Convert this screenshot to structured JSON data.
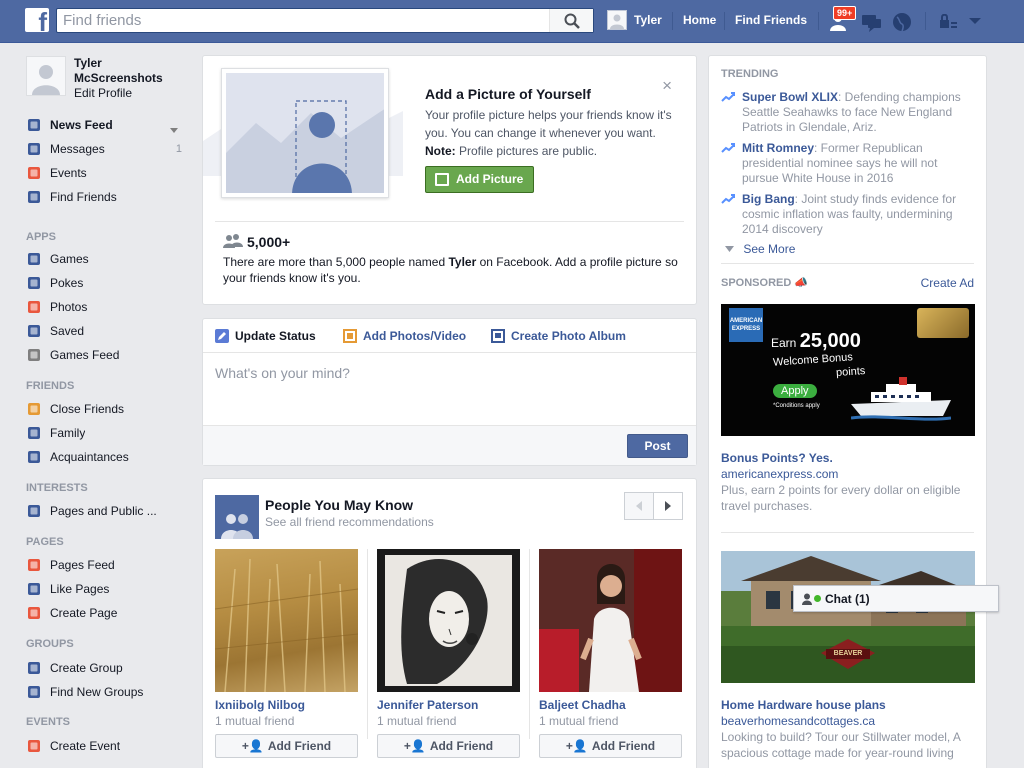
{
  "topbar": {
    "logo": "f",
    "search_placeholder": "Find friends",
    "user_name": "Tyler",
    "home_label": "Home",
    "find_friends_label": "Find Friends",
    "notification_count": "99+"
  },
  "sidebar": {
    "profile_name": "Tyler McScreenshots",
    "edit_profile": "Edit Profile",
    "favorites": [
      {
        "label": "News Feed",
        "icon": "news-feed-icon"
      },
      {
        "label": "Messages",
        "icon": "messages-icon",
        "count": "1"
      },
      {
        "label": "Events",
        "icon": "events-icon"
      },
      {
        "label": "Find Friends",
        "icon": "find-friends-icon"
      }
    ],
    "apps_title": "APPS",
    "apps": [
      {
        "label": "Games",
        "icon": "games-icon"
      },
      {
        "label": "Pokes",
        "icon": "pokes-icon"
      },
      {
        "label": "Photos",
        "icon": "photos-icon"
      },
      {
        "label": "Saved",
        "icon": "saved-icon"
      },
      {
        "label": "Games Feed",
        "icon": "games-feed-icon"
      }
    ],
    "friends_title": "FRIENDS",
    "friends": [
      {
        "label": "Close Friends",
        "icon": "close-friends-icon"
      },
      {
        "label": "Family",
        "icon": "family-icon"
      },
      {
        "label": "Acquaintances",
        "icon": "acquaintances-icon"
      }
    ],
    "interests_title": "INTERESTS",
    "interests": [
      {
        "label": "Pages and Public ...",
        "icon": "pages-public-icon"
      }
    ],
    "pages_title": "PAGES",
    "pages": [
      {
        "label": "Pages Feed",
        "icon": "pages-feed-icon"
      },
      {
        "label": "Like Pages",
        "icon": "like-pages-icon"
      },
      {
        "label": "Create Page",
        "icon": "create-page-icon"
      }
    ],
    "groups_title": "GROUPS",
    "groups": [
      {
        "label": "Create Group",
        "icon": "create-group-icon"
      },
      {
        "label": "Find New Groups",
        "icon": "find-groups-icon"
      }
    ],
    "events_title": "EVENTS",
    "events": [
      {
        "label": "Create Event",
        "icon": "create-event-icon"
      }
    ]
  },
  "photo_prompt": {
    "title": "Add a Picture of Yourself",
    "desc_pre": "Your profile picture helps your friends know it's you. You can change it whenever you want. ",
    "desc_note": "Note:",
    "desc_post": " Profile pictures are public.",
    "button": "Add Picture",
    "close": "×",
    "count": "5,000+",
    "count_desc_pre": "There are more than 5,000 people named ",
    "count_name": "Tyler",
    "count_desc_post": " on Facebook. Add a profile picture so your friends know it's you."
  },
  "composer": {
    "tab_status": "Update Status",
    "tab_photos": "Add Photos/Video",
    "tab_album": "Create Photo Album",
    "placeholder": "What's on your mind?",
    "post": "Post"
  },
  "pymk": {
    "title": "People You May Know",
    "subtitle": "See all friend recommendations",
    "people": [
      {
        "name": "Ixniibolg Nilbog",
        "mutual": "1 mutual friend",
        "button": "Add Friend"
      },
      {
        "name": "Jennifer Paterson",
        "mutual": "1 mutual friend",
        "button": "Add Friend"
      },
      {
        "name": "Baljeet Chadha",
        "mutual": "1 mutual friend",
        "button": "Add Friend"
      }
    ]
  },
  "right": {
    "trending_title": "TRENDING",
    "trends": [
      {
        "topic": "Super Bowl XLIX",
        "text": ": Defending champions Seattle Seahawks to face New England Patriots in Glendale, Ariz."
      },
      {
        "topic": "Mitt Romney",
        "text": ": Former Republican presidential nominee says he will not pursue White House in 2016"
      },
      {
        "topic": "Big Bang",
        "text": ": Joint study finds evidence for cosmic inflation was faulty, undermining 2014 discovery"
      }
    ],
    "see_more": "See More",
    "sponsored_title": "SPONSORED",
    "create_ad": "Create Ad",
    "ad1": {
      "brand_text": "AMERICAN EXPRESS",
      "earn": "Earn",
      "amount": "25,000",
      "line2": "Welcome Bonus",
      "line3": "points",
      "apply": "Apply",
      "conditions": "*Conditions apply",
      "title": "Bonus Points? Yes.",
      "url": "americanexpress.com",
      "body": "Plus, earn 2 points for every dollar on eligible travel purchases."
    },
    "ad2": {
      "brand_text": "BEAVER",
      "title": "Home Hardware house plans",
      "url": "beaverhomesandcottages.ca",
      "body": "Looking to build? Tour our Stillwater model, A spacious cottage made for year-round living"
    }
  },
  "chat": {
    "label": "Chat (1)"
  }
}
